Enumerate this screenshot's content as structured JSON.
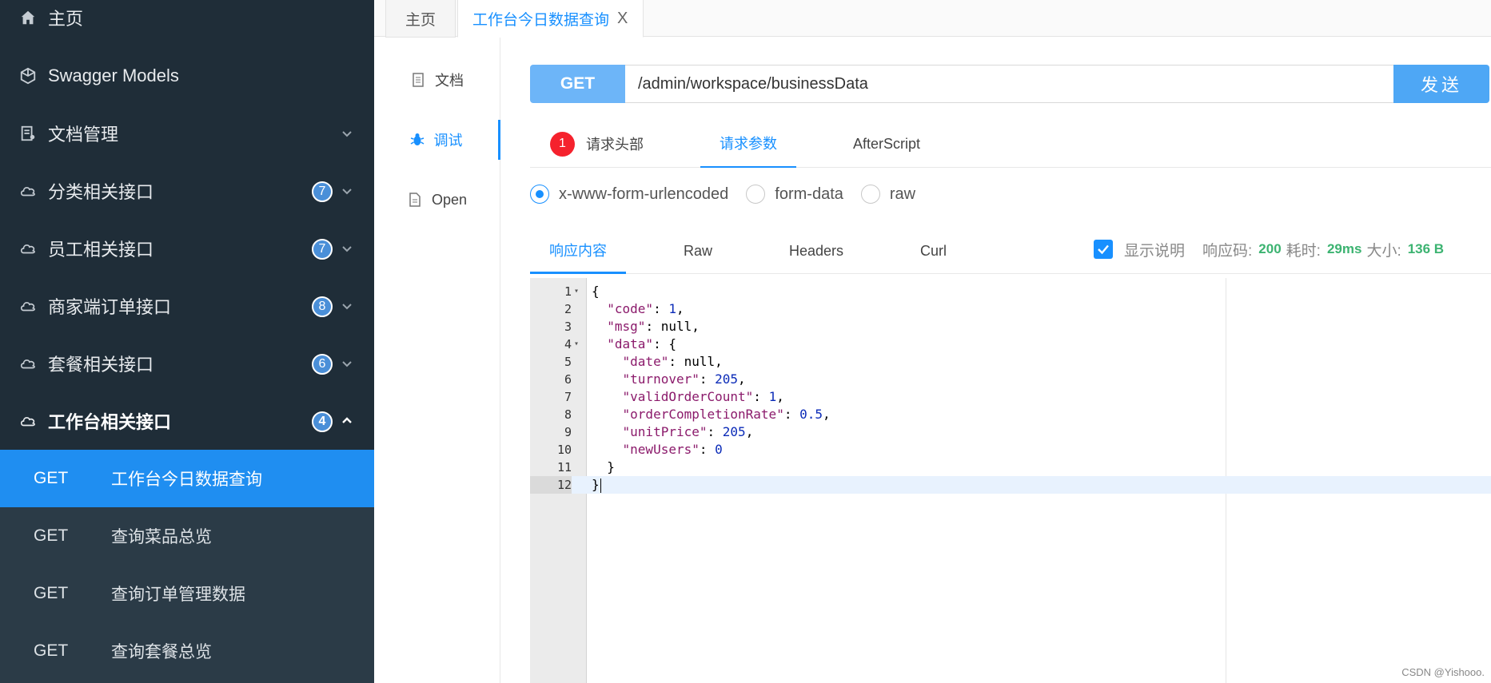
{
  "sidebar": {
    "items": [
      {
        "label": "主页",
        "icon": "home-icon"
      },
      {
        "label": "Swagger Models",
        "icon": "cube-icon"
      },
      {
        "label": "文档管理",
        "icon": "doc-manage-icon"
      },
      {
        "label": "分类相关接口",
        "icon": "cloud-icon",
        "badge": "7"
      },
      {
        "label": "员工相关接口",
        "icon": "cloud-icon",
        "badge": "7"
      },
      {
        "label": "商家端订单接口",
        "icon": "cloud-icon",
        "badge": "8"
      },
      {
        "label": "套餐相关接口",
        "icon": "cloud-icon",
        "badge": "6"
      },
      {
        "label": "工作台相关接口",
        "icon": "cloud-icon",
        "badge": "4"
      }
    ],
    "sub_items": [
      {
        "method": "GET",
        "label": "工作台今日数据查询"
      },
      {
        "method": "GET",
        "label": "查询菜品总览"
      },
      {
        "method": "GET",
        "label": "查询订单管理数据"
      },
      {
        "method": "GET",
        "label": "查询套餐总览"
      }
    ]
  },
  "tabs": {
    "home": "主页",
    "active": "工作台今日数据查询",
    "close": "X"
  },
  "docnav": {
    "doc": "文档",
    "debug": "调试",
    "open": "Open"
  },
  "request": {
    "method": "GET",
    "url": "/admin/workspace/businessData",
    "send": "发送"
  },
  "param_tabs": {
    "headers_count": "1",
    "headers": "请求头部",
    "params": "请求参数",
    "after": "AfterScript"
  },
  "body_types": [
    "x-www-form-urlencoded",
    "form-data",
    "raw"
  ],
  "response_tabs": [
    "响应内容",
    "Raw",
    "Headers",
    "Curl"
  ],
  "response_meta": {
    "show_desc": "显示说明",
    "code_label": "响应码:",
    "code": "200",
    "time_label": "耗时:",
    "time": "29ms",
    "size_label": "大小:",
    "size": "136 B"
  },
  "code_lines": [
    "{",
    "  \"code\": 1,",
    "  \"msg\": null,",
    "  \"data\": {",
    "    \"date\": null,",
    "    \"turnover\": 205,",
    "    \"validOrderCount\": 1,",
    "    \"orderCompletionRate\": 0.5,",
    "    \"unitPrice\": 205,",
    "    \"newUsers\": 0",
    "  }",
    "}"
  ],
  "watermark": "CSDN @Yishooo.",
  "colors": {
    "sidebar_bg": "#1f2d38",
    "active_blue": "#1f8ef1",
    "accent": "#1890ff",
    "method_btn": "#6db5f8",
    "success": "#3cb371",
    "error": "#f5222d"
  }
}
